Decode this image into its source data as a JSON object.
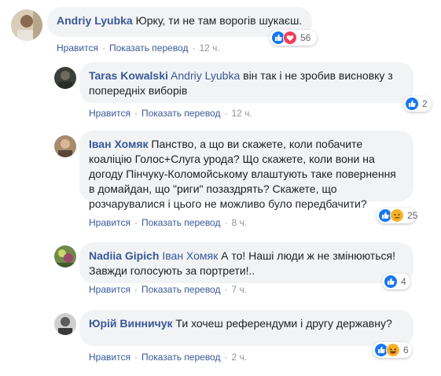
{
  "comments": [
    {
      "author": "Andriy Lyubka",
      "mention": "",
      "text": "Юрку, ти не там ворогів шукаєш.",
      "reaction_count": "56",
      "reactions": [
        "like",
        "love"
      ],
      "actions": {
        "like": "Нравится",
        "translate": "Показать перевод",
        "time": "12 ч."
      }
    },
    {
      "author": "Taras Kowalski",
      "mention": "Andriy Lyubka",
      "text": "він так і не зробив висновку з попередніх виборів",
      "reaction_count": "2",
      "reactions": [
        "like"
      ],
      "actions": {
        "like": "Нравится",
        "translate": "Показать перевод",
        "time": "12 ч."
      }
    },
    {
      "author": "Іван Хомяк",
      "mention": "",
      "text": "Панство, а що ви скажете, коли побачите коаліцію Голос+Слуга урода? Що скажете, коли вони на догоду Пінчуку-Коломойському влаштують таке повернення в домайдан, що \"риги\" позаздрять? Скажете, що розчарувалися і цього не можливо було передбачити?",
      "reaction_count": "25",
      "reactions": [
        "like",
        "sad"
      ],
      "actions": {
        "like": "Нравится",
        "translate": "Показать перевод",
        "time": "8 ч."
      }
    },
    {
      "author": "Nadiia Gipich",
      "mention": "Іван Хомяк",
      "text": "А то! Наші люди ж не змінюються! Завжди голосують за портрети!..",
      "reaction_count": "4",
      "reactions": [
        "like"
      ],
      "actions": {
        "like": "Нравится",
        "translate": "Показать перевод",
        "time": "7 ч."
      }
    },
    {
      "author": "Юрій Винничук",
      "mention": "",
      "text": "Ти хочеш референдуми і другу державну?",
      "reaction_count": "6",
      "reactions": [
        "like",
        "haha"
      ],
      "actions": {
        "like": "Нравится",
        "translate": "Показать перевод",
        "time": "2 ч."
      }
    }
  ],
  "colors": {
    "link": "#385898",
    "bubble": "#f2f3f5",
    "like": "#1877f2",
    "love": "#f33e58",
    "emoji": "#f7b125"
  }
}
